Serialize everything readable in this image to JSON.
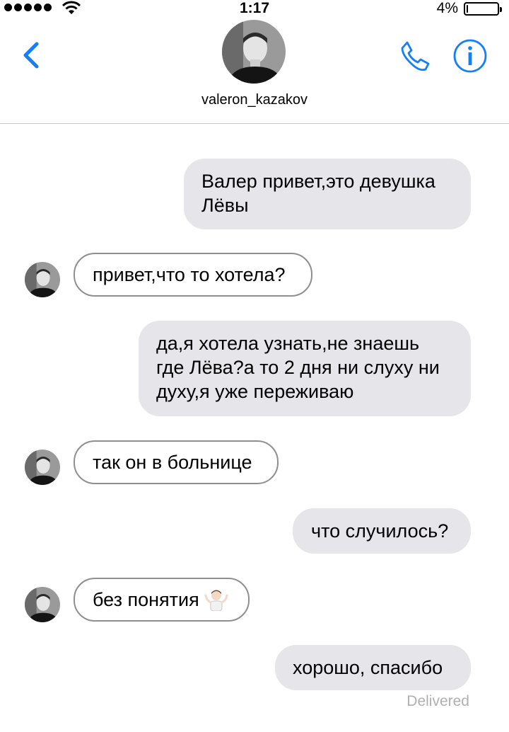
{
  "status_bar": {
    "time": "1:17",
    "battery_percent": "4%",
    "battery_level": 0.04
  },
  "header": {
    "contact_name": "valeron_kazakov"
  },
  "colors": {
    "accent": "#147EFB",
    "outgoing_bubble": "#e5e5ea",
    "incoming_border": "#8e8e93",
    "delivered_text": "#b0b0b4"
  },
  "messages": [
    {
      "direction": "outgoing",
      "lines": [
        "Валер привет,это девушка",
        "Лёвы"
      ]
    },
    {
      "direction": "incoming",
      "lines": [
        "привет,что то хотела?"
      ]
    },
    {
      "direction": "outgoing",
      "lines": [
        "да,я хотела узнать,не знаешь",
        "где Лёва?а то 2 дня ни слуху ни",
        "духу,я уже переживаю"
      ]
    },
    {
      "direction": "incoming",
      "lines": [
        "так он в больнице"
      ]
    },
    {
      "direction": "outgoing",
      "lines": [
        "что случилось?"
      ]
    },
    {
      "direction": "incoming",
      "lines": [
        "без понятия"
      ],
      "emoji": "person-shrugging-emoji"
    },
    {
      "direction": "outgoing",
      "lines": [
        "хорошо, спасибо"
      ]
    }
  ],
  "delivery_status": "Delivered"
}
